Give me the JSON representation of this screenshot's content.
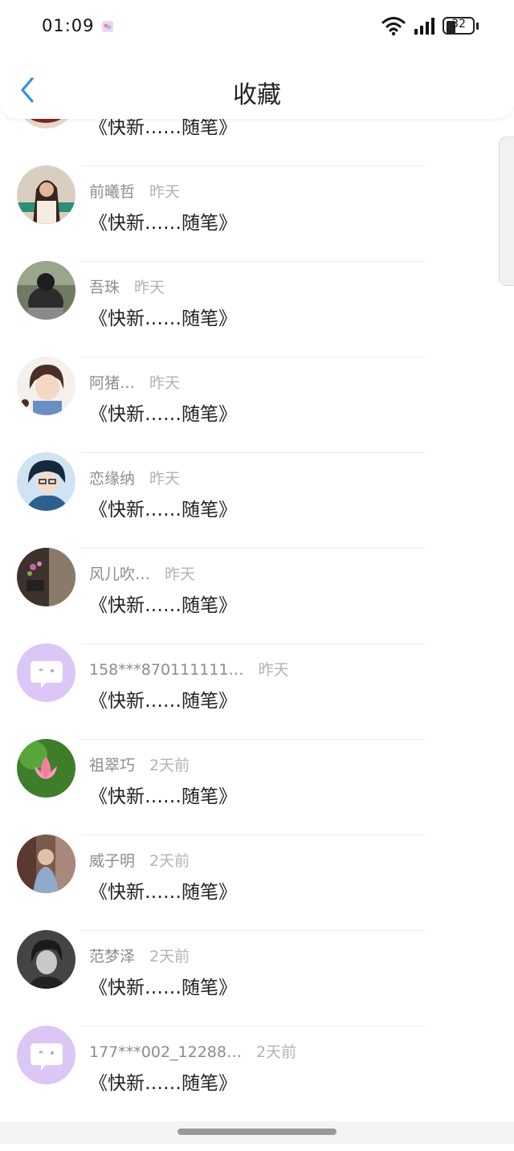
{
  "status_bar": {
    "time": "01:09",
    "battery": "32"
  },
  "header": {
    "title": "收藏"
  },
  "colors": {
    "accent": "#2f8ff0",
    "bot_avatar": "#dcc6f6"
  },
  "items": [
    {
      "name": "",
      "time": "",
      "title": "《快新……随笔》",
      "avatar": "photo-avatar"
    },
    {
      "name": "前曦哲",
      "time": "昨天",
      "title": "《快新……随笔》",
      "avatar": "photo-avatar"
    },
    {
      "name": "吾珠",
      "time": "昨天",
      "title": "《快新……随笔》",
      "avatar": "photo-avatar"
    },
    {
      "name": "阿猪…",
      "time": "昨天",
      "title": "《快新……随笔》",
      "avatar": "anime-avatar"
    },
    {
      "name": "恋缘纳",
      "time": "昨天",
      "title": "《快新……随笔》",
      "avatar": "anime-avatar"
    },
    {
      "name": "风儿吹…",
      "time": "昨天",
      "title": "《快新……随笔》",
      "avatar": "photo-avatar"
    },
    {
      "name": "158***870111111…",
      "time": "昨天",
      "title": "《快新……随笔》",
      "avatar": "default-chat-avatar"
    },
    {
      "name": "祖翠巧",
      "time": "2天前",
      "title": "《快新……随笔》",
      "avatar": "lotus-avatar"
    },
    {
      "name": "威子明",
      "time": "2天前",
      "title": "《快新……随笔》",
      "avatar": "photo-avatar"
    },
    {
      "name": "范梦泽",
      "time": "2天前",
      "title": "《快新……随笔》",
      "avatar": "photo-avatar"
    },
    {
      "name": "177***002_12288…",
      "time": "2天前",
      "title": "《快新……随笔》",
      "avatar": "default-chat-avatar"
    }
  ]
}
